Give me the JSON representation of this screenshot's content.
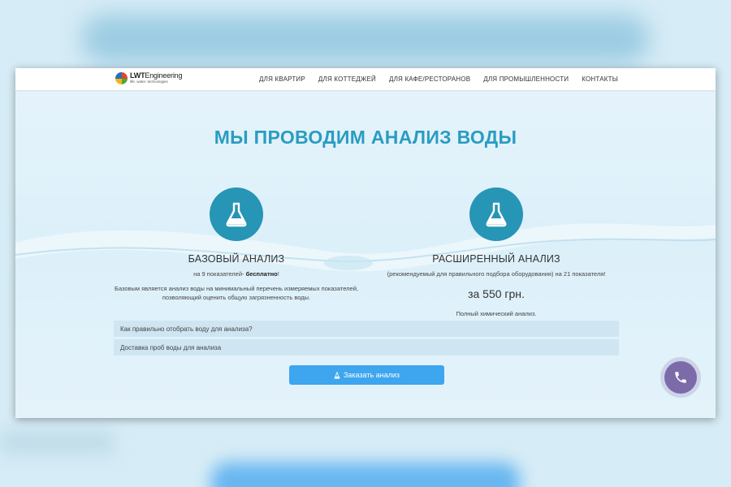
{
  "logo": {
    "name_bold": "LWT",
    "name_rest": "Engineering",
    "tagline": "life. water. technologies",
    "icon": "quad-color-circle-icon"
  },
  "nav": [
    "ДЛЯ КВАРТИР",
    "ДЛЯ КОТТЕДЖЕЙ",
    "ДЛЯ КАФЕ/РЕСТОРАНОВ",
    "ДЛЯ ПРОМЫШЛЕННОСТИ",
    "КОНТАКТЫ"
  ],
  "headline": "МЫ ПРОВОДИМ АНАЛИЗ ВОДЫ",
  "basic": {
    "icon": "flask-icon",
    "title": "БАЗОВЫЙ АНАЛИЗ",
    "sub_prefix": "на 9 показателей- ",
    "sub_bold": "бесплатно",
    "sub_suffix": "!",
    "description": "Базовым является анализ воды на минимальный перечень измеряемых показателей, позволяющий оценить общую загрязненность воды."
  },
  "extended": {
    "icon": "flask-icon",
    "title": "РАСШИРЕННЫЙ АНАЛИЗ",
    "sub": "(рекомендуемый для правильного подбора оборудования) на 21 показателя!",
    "price": "за 550 грн.",
    "note": "Полный химический анализ."
  },
  "accordion": [
    "Как правильно отобрать воду для анализа?",
    "Доставка проб воды для анализа"
  ],
  "order_button": {
    "label": "Заказать анализ",
    "icon": "flask-icon"
  },
  "call_button": {
    "icon": "phone-icon"
  },
  "colors": {
    "accent": "#2a9cc2",
    "icon_circle": "#2795b5",
    "button": "#3ea5ef",
    "call": "#7c6aa9"
  }
}
